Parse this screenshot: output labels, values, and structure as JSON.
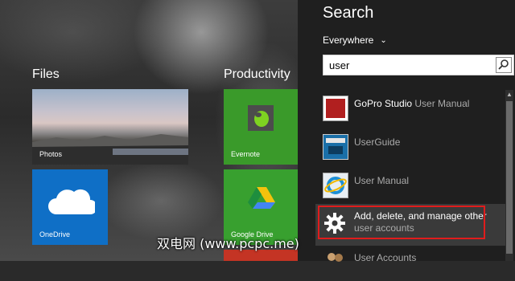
{
  "start": {
    "groups": [
      {
        "title": "Files"
      },
      {
        "title": "Productivity"
      }
    ],
    "tiles": {
      "photos": "Photos",
      "onedrive": "OneDrive",
      "evernote": "Evernote",
      "gdrive": "Google Drive"
    }
  },
  "search": {
    "title": "Search",
    "scope": "Everywhere",
    "query": "user",
    "results": [
      {
        "prefix": "GoPro Studio ",
        "match": "User",
        "suffix": " Manual",
        "icon": "document-pdf-icon"
      },
      {
        "prefix": "",
        "match": "User",
        "suffix": "Guide",
        "icon": "lenovo-app-icon"
      },
      {
        "prefix": "",
        "match": "User",
        "suffix": " Manual",
        "icon": "ie-icon"
      },
      {
        "line1": "Add, delete, and manage other",
        "line2_match": "user",
        "line2_rest": " accounts",
        "icon": "gear-icon"
      },
      {
        "prefix": "",
        "match": "User",
        "suffix": " Accounts",
        "icon": "users-icon"
      }
    ]
  },
  "watermark": "双电网 (www.pcpc.me)",
  "colors": {
    "highlight": "#e01c1c",
    "onedrive": "#0f6fc6",
    "evernote": "#3a9a2a"
  }
}
